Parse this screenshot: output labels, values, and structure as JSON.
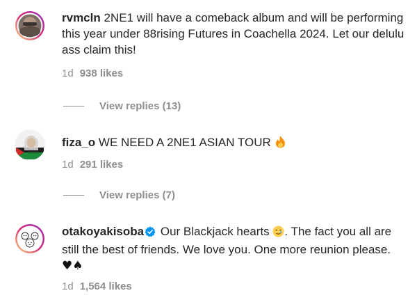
{
  "comments": [
    {
      "username": "rvmcln",
      "text": "2NE1 will have a comeback album and will be performing this year under 88rising Futures in Coachella 2024. Let our delulu ass claim this!",
      "time": "1d",
      "likes": "938 likes",
      "view_replies": "View replies (13)",
      "avatar_icon": "user-avatar-icon"
    },
    {
      "username": "fiza_o",
      "text": "WE NEED A 2NE1 ASIAN TOUR",
      "emoji": "fire-emoji",
      "time": "1d",
      "likes": "291 likes",
      "view_replies": "View replies (7)",
      "avatar_icon": "user-avatar-icon"
    },
    {
      "username": "otakoyakisoba",
      "verified": true,
      "text_part1": "Our Blackjack hearts",
      "text_part2": ". The fact you all are still the best of friends. We love you. One more reunion please.",
      "emoji_symbols": "♥♠",
      "time": "1d",
      "likes": "1,564 likes",
      "avatar_icon": "illustrated-avatar-icon"
    }
  ],
  "colors": {
    "text": "#262626",
    "secondary": "#8e8e8e",
    "verified": "#0095f6",
    "story_ring": "#c13584"
  }
}
